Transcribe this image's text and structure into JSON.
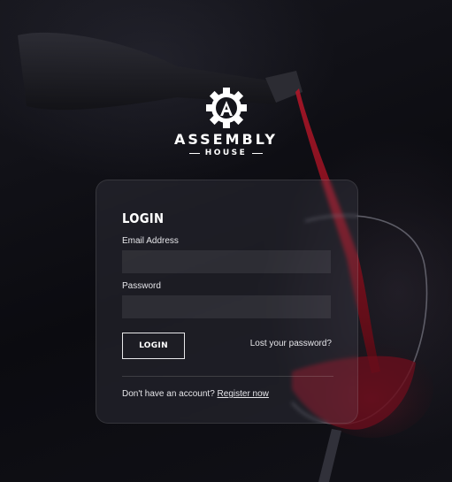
{
  "brand": {
    "logo_icon": "gear-a-icon",
    "name": "ASSEMBLY",
    "subname": "HOUSE"
  },
  "login": {
    "title": "LOGIN",
    "email_label": "Email Address",
    "email_value": "",
    "password_label": "Password",
    "password_value": "",
    "button_label": "LOGIN",
    "lost_password": "Lost your password?",
    "no_account": "Don't have an account?",
    "register": "Register now"
  },
  "colors": {
    "background": "#0d0d12",
    "wine": "#8a1020",
    "text": "#ffffff"
  }
}
